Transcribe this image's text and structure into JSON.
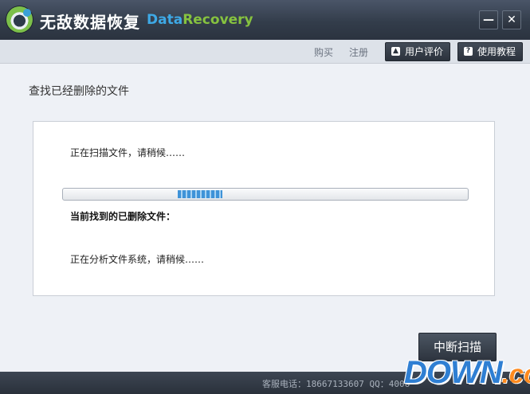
{
  "app": {
    "title": "无敌数据恢复",
    "brand_part1": "Data",
    "brand_part2": "Recovery"
  },
  "window_controls": {
    "minimize": "—",
    "close": "✕"
  },
  "toolbar": {
    "buy": "购买",
    "register": "注册",
    "user_review": "用户评价",
    "tutorial": "使用教程"
  },
  "main": {
    "section_title": "查找已经删除的文件",
    "scanning_status": "正在扫描文件，请稍候……",
    "progress_fraction": 0.11,
    "found_label": "当前找到的已删除文件：",
    "analyzing_status": "正在分析文件系统，请稍候……",
    "stop_button": "中断扫描"
  },
  "statusbar": {
    "contact": "客服电话：18667133607 QQ：4006"
  },
  "watermark": {
    "main": "DOWN",
    "tld": ".cc"
  },
  "colors": {
    "titlebar": "#333d4b",
    "brand_blue": "#3ea9e6",
    "brand_green": "#86c23f",
    "progress": "#3f93d8",
    "watermark_blue": "#2f7fd3",
    "watermark_orange": "#ff8a1e"
  },
  "icons": {
    "logo": "app-logo",
    "user_review": "thumbs-up-icon",
    "tutorial": "help-book-icon"
  }
}
